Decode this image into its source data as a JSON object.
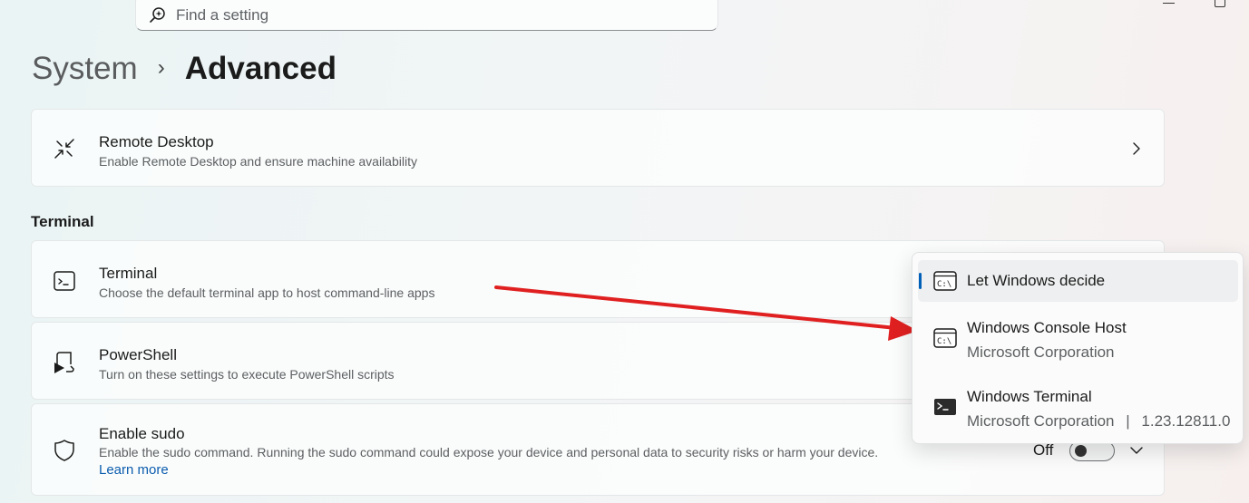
{
  "search": {
    "placeholder": "Find a setting"
  },
  "breadcrumb": {
    "root": "System",
    "separator": "›",
    "current": "Advanced"
  },
  "cards": {
    "remote_desktop": {
      "title": "Remote Desktop",
      "description": "Enable Remote Desktop and ensure machine availability"
    },
    "terminal": {
      "title": "Terminal",
      "description": "Choose the default terminal app to host command-line apps"
    },
    "powershell": {
      "title": "PowerShell",
      "description": "Turn on these settings to execute PowerShell scripts"
    },
    "sudo": {
      "title": "Enable sudo",
      "description": "Enable the sudo command. Running the sudo command could expose your device and personal data to security risks or harm your device.",
      "link": "Learn more",
      "toggle_label": "Off",
      "toggle_on": false
    }
  },
  "section": {
    "terminal_heading": "Terminal"
  },
  "terminal_dropdown": {
    "selected_index": 0,
    "options": [
      {
        "name": "Let Windows decide",
        "publisher": "",
        "version": "",
        "icon": "console-host-icon"
      },
      {
        "name": "Windows Console Host",
        "publisher": "Microsoft Corporation",
        "version": "",
        "icon": "console-host-icon"
      },
      {
        "name": "Windows Terminal",
        "publisher": "Microsoft Corporation",
        "version": "1.23.12811.0",
        "icon": "windows-terminal-icon"
      }
    ],
    "version_separator": "|"
  },
  "colors": {
    "accent": "#005fb8",
    "link": "#0b5cad",
    "annotation_arrow": "#e02020"
  }
}
